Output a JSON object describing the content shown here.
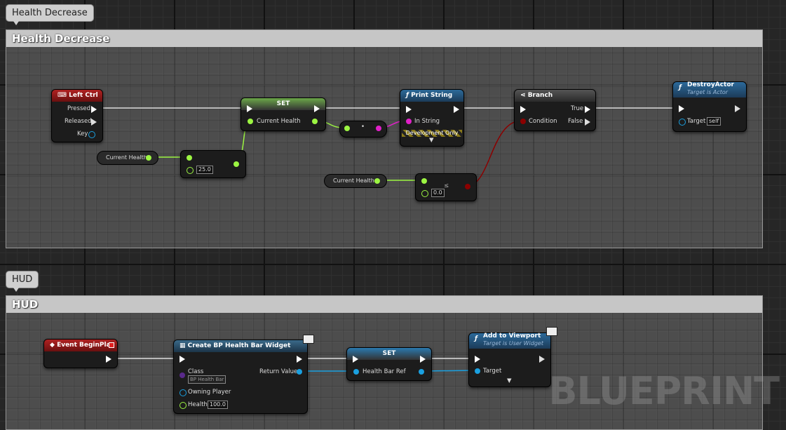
{
  "comments": [
    {
      "tab": "Health Decrease",
      "title": "Health Decrease"
    },
    {
      "tab": "HUD",
      "title": "HUD"
    }
  ],
  "nodes": {
    "leftctrl": {
      "title": "Left Ctrl",
      "pressed": "Pressed",
      "released": "Released",
      "key": "Key"
    },
    "set1": {
      "title": "SET",
      "pin": "Current Health"
    },
    "cur1": "Current Health",
    "minus": {
      "value": "25.0"
    },
    "multiply": {
      "glyph": "•"
    },
    "print": {
      "title": "Print String",
      "instring": "In String",
      "dev": "Development Only"
    },
    "branch": {
      "title": "Branch",
      "condition": "Condition",
      "true": "True",
      "false": "False"
    },
    "cur2": "Current Health",
    "compare": {
      "value": "0.0"
    },
    "destroy": {
      "title": "DestroyActor",
      "subtitle": "Target is Actor",
      "target": "Target",
      "target_value": "self"
    },
    "beginplay": {
      "title": "Event BeginPlay"
    },
    "create": {
      "title": "Create BP Health Bar Widget",
      "class": "Class",
      "class_value": "BP Health Bar",
      "return": "Return Value",
      "owning": "Owning Player",
      "health": "Health",
      "health_value": "100.0"
    },
    "set2": {
      "title": "SET",
      "pin": "Health Bar Ref"
    },
    "viewport": {
      "title": "Add to Viewport",
      "subtitle": "Target is User Widget",
      "target": "Target"
    }
  },
  "watermark": "BLUEPRINT",
  "colors": {
    "float": "#9cf542",
    "object": "#1aa0e0",
    "bool": "#8b0000",
    "string": "#e020c8",
    "exec": "#ffffff",
    "function_head": "#2a5b7e",
    "event_head": "#8a1e1e"
  }
}
